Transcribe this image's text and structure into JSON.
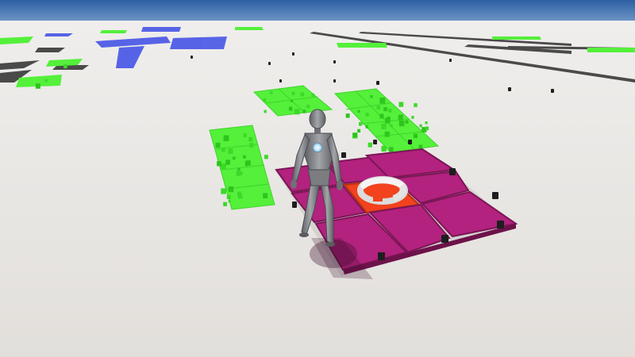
{
  "scene": {
    "sky_color": "#3a6fb0",
    "horizon_color": "#a9c3dd",
    "ground_color": "#e6e3df",
    "colors": {
      "green_zone": "#54f03a",
      "green_cube": "#32c820",
      "blue_zone": "#4655e6",
      "magenta_pad": "#b2227e",
      "active_pad": "#f2421e",
      "dark_post": "#222222",
      "ring": "#f4f4f4",
      "character_body": "#8d8f93",
      "chest_glow": "#bfe6ff"
    },
    "objects": [
      {
        "name": "player-character",
        "type": "mannequin-character"
      },
      {
        "name": "ring-pickup",
        "type": "torus-pickup",
        "state": "on-active-pad"
      },
      {
        "name": "magenta-pad-grid",
        "type": "pad-grid",
        "tiles": 9,
        "active_tile": "center"
      },
      {
        "name": "green-zone-left",
        "type": "foliage-zone"
      },
      {
        "name": "green-zone-center",
        "type": "foliage-zone"
      },
      {
        "name": "green-zone-right",
        "type": "foliage-zone"
      },
      {
        "name": "blue-zone",
        "type": "distant-zone"
      }
    ]
  }
}
